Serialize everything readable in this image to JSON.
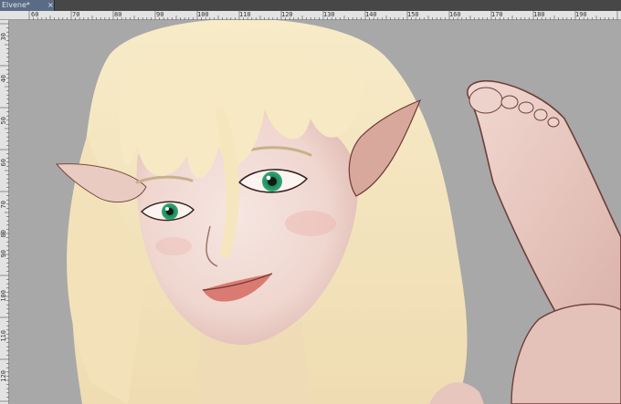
{
  "document_tab": {
    "title": "Elvene*",
    "close_glyph": "×"
  },
  "ruler": {
    "top_labels": [
      "60",
      "70",
      "80",
      "90",
      "100",
      "110",
      "120",
      "130",
      "140",
      "150",
      "160",
      "170",
      "180",
      "190"
    ],
    "left_labels": [
      "30",
      "40",
      "50",
      "60",
      "70",
      "80",
      "90",
      "100",
      "110",
      "120"
    ]
  },
  "canvas": {
    "background": "#a8a8a8",
    "content": "elf-girl-illustration"
  },
  "colors": {
    "chrome_dark": "#3c3c3c",
    "tab_active": "#5a6b86",
    "ruler_bg": "#e3e3e3",
    "hair": "#f3e4bd",
    "skin": "#f2dcd6",
    "skin_shadow": "#d9b2aa",
    "eye": "#2f9a6a",
    "lips": "#d97b72"
  }
}
